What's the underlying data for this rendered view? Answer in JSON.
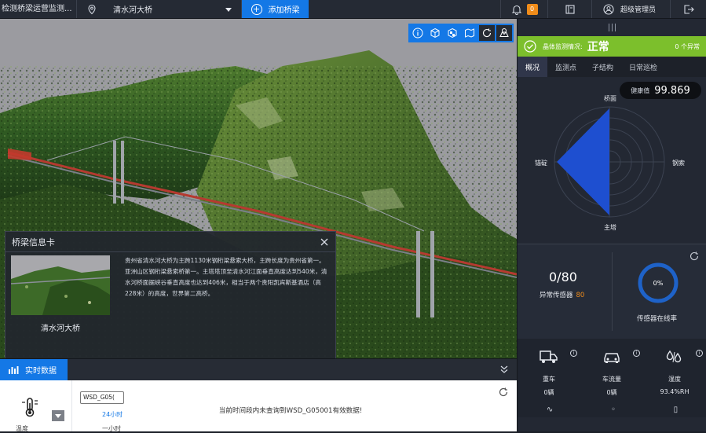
{
  "topbar": {
    "title": "检测桥梁运营监测...",
    "bridge_name": "清水河大桥",
    "add_bridge_label": "添加桥梁",
    "alert_count": "0",
    "user_name": "超级管理员"
  },
  "info_card": {
    "title": "桥梁信息卡",
    "bridge_name": "清水河大桥",
    "description": "贵州省清水河大桥为主跨1130米钢桁梁悬索大桥，主跨长度为贵州省第一。亚洲山区钢桁梁悬索桥第一。主塔塔顶至清水河江面垂直高度达到540米，清水河桥面据峡谷垂直高度也达到406米，相当于两个贵阳凯宾斯基酒店（高228米）的高度，世界第二高桥。"
  },
  "realtime": {
    "tab_label": "实时数据",
    "sensor_label": "温度",
    "select_value": "WSD_G05(",
    "option_24h": "24小时",
    "option_1h": "一小时",
    "message": "当前时间段内未查询到WSD_G05001有效数据!"
  },
  "right_panel": {
    "status_label": "晶体监测情况:",
    "status_value": "正常",
    "abnormal_label": "0 个异常",
    "tabs": [
      "概况",
      "监测点",
      "子结构",
      "日常巡检"
    ],
    "health_label": "健康值",
    "health_value": "99.869",
    "radar_labels": {
      "top": "桥面",
      "right": "钢索",
      "bottom": "主塔",
      "left": "锚碇"
    },
    "abnormal_sensors": "0/80",
    "abnormal_sensor_label": "异常传感器",
    "abnormal_sensor_total": "80",
    "online_percent": "0%",
    "online_label": "传感器在线率",
    "stats": [
      {
        "label": "重车",
        "value": "0辆"
      },
      {
        "label": "车流量",
        "value": "0辆"
      },
      {
        "label": "湿度",
        "value": "93.4%RH"
      }
    ]
  },
  "colors": {
    "accent": "#1478e6",
    "status_ok": "#7cbf2c",
    "warning": "#f08c1a",
    "radar_fill": "#1e4fd0"
  }
}
